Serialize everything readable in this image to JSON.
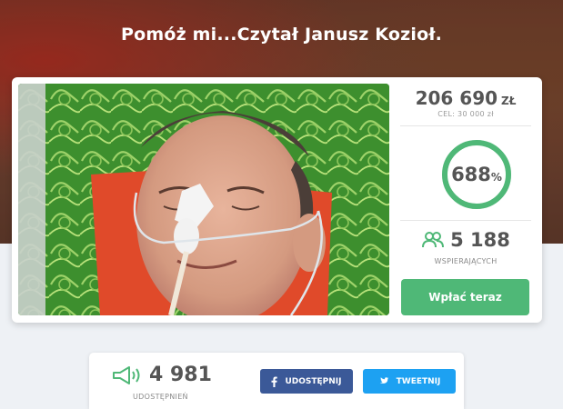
{
  "page": {
    "title": "Pomóż mi...Czytał Janusz Kozioł."
  },
  "campaign": {
    "raised_amount": "206 690",
    "currency": "ZŁ",
    "goal_label": "CEL: 30 000 zł",
    "percent_value": "688",
    "percent_sign": "%",
    "progress_fraction": 1.0,
    "supporters_count": "5 188",
    "supporters_label": "WSPIERAJĄCYCH",
    "donate_label": "Wpłać teraz"
  },
  "share": {
    "count": "4 981",
    "label": "UDOSTĘPNIEŃ",
    "facebook_label": "UDOSTĘPNIJ",
    "twitter_label": "TWEETNIJ",
    "icons": [
      "megaphone-icon",
      "facebook-icon",
      "twitter-icon",
      "supporters-icon"
    ]
  },
  "colors": {
    "accent": "#4fb877",
    "facebook": "#3b5998",
    "twitter": "#1da1f2"
  }
}
